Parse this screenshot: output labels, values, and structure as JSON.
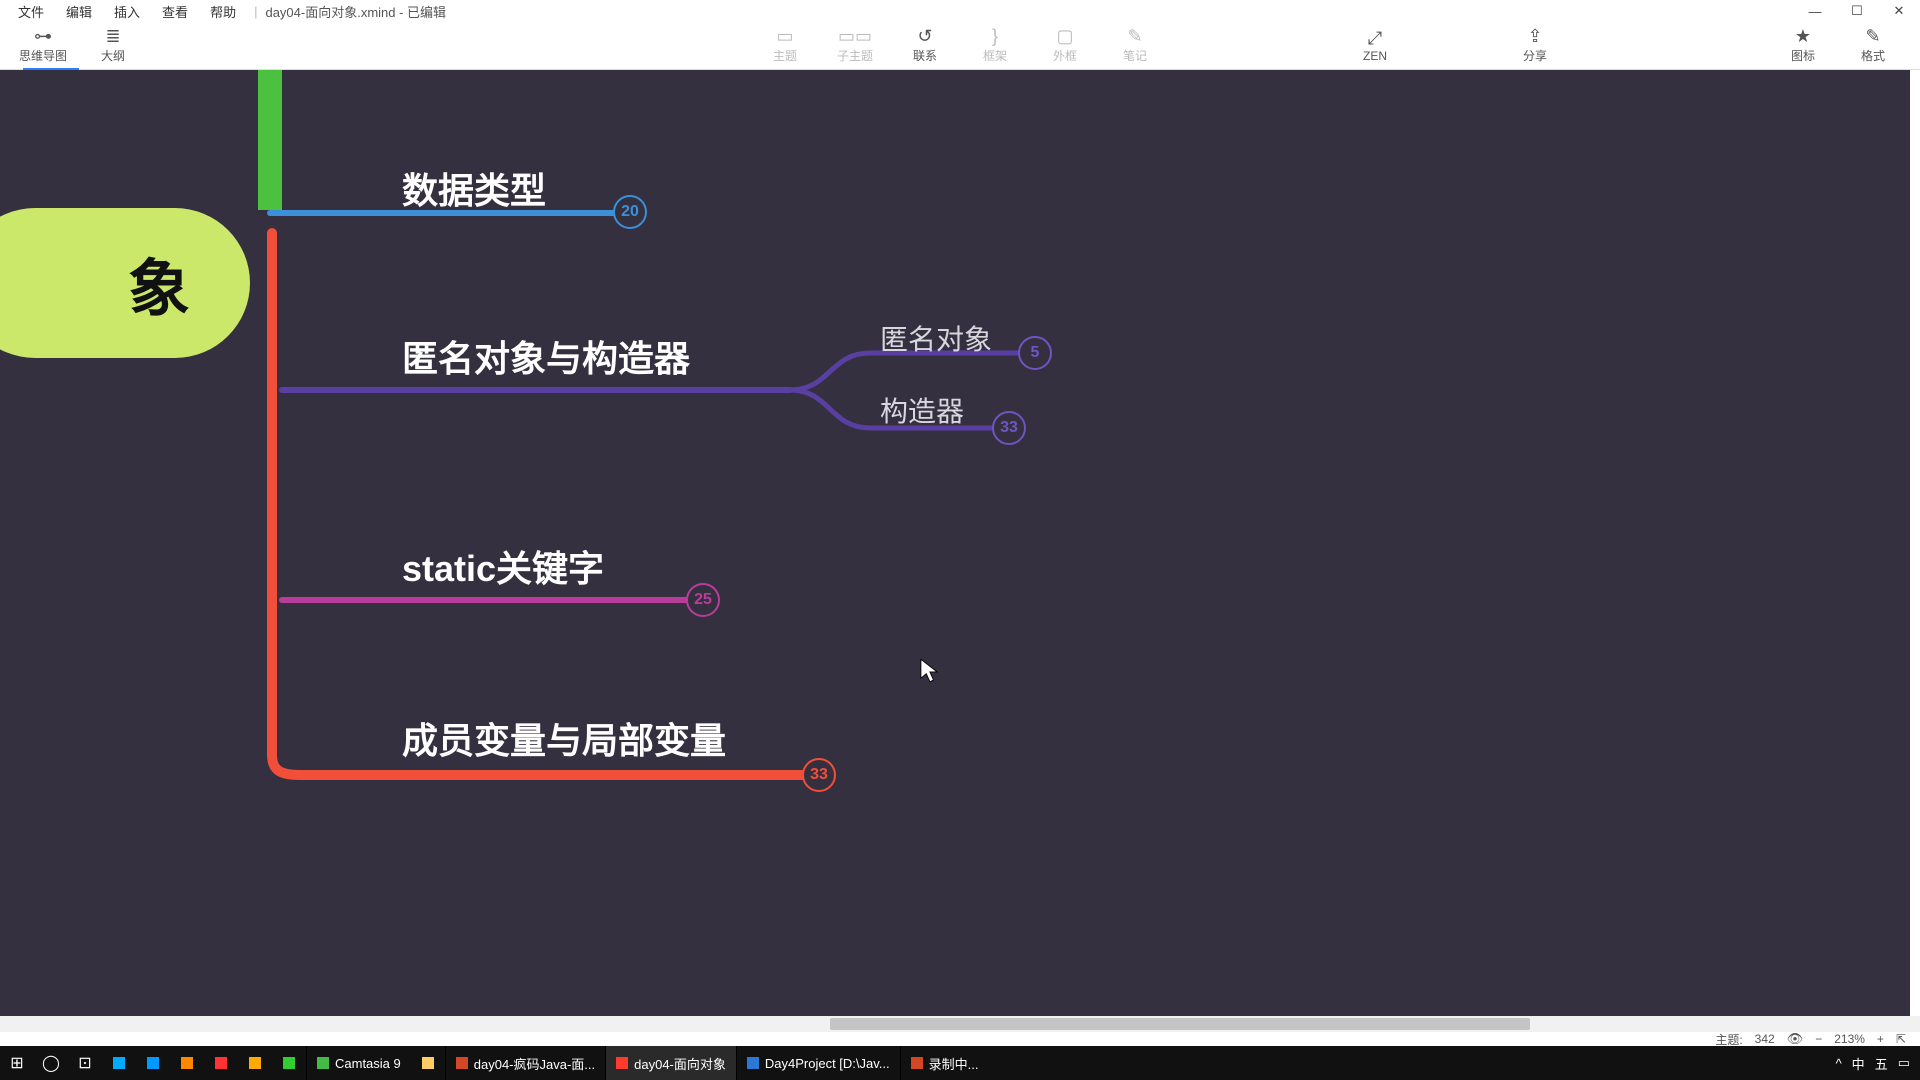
{
  "menubar": {
    "file": "文件",
    "edit": "编辑",
    "insert": "插入",
    "view": "查看",
    "help": "帮助"
  },
  "window": {
    "title": "day04-面向对象.xmind - 已编辑"
  },
  "toolbar": {
    "mindmap": "思维导图",
    "outline": "大纲",
    "theme": "主题",
    "child": "子主题",
    "relation": "联系",
    "summary": "框架",
    "boundary": "外框",
    "note": "笔记",
    "zen": "ZEN",
    "share": "分享",
    "marker": "图标",
    "format": "格式"
  },
  "mind": {
    "root": "象",
    "topics": {
      "data_type": "数据类型",
      "anon_ctor": "匿名对象与构造器",
      "static_kw": "static关键字",
      "member_local": "成员变量与局部变量"
    },
    "sub": {
      "anon": "匿名对象",
      "ctor": "构造器"
    },
    "badges": {
      "data_type": "20",
      "anon": "5",
      "ctor": "33",
      "static_kw": "25",
      "member_local": "33"
    }
  },
  "status": {
    "topic_label": "主题:",
    "topic_count": "342",
    "zoom": "213%"
  },
  "taskbar": {
    "camtasia": "Camtasia 9",
    "ppt": "day04-疯码Java-面...",
    "xmind": "day04-面向对象",
    "idea": "Day4Project [D:\\Jav...",
    "rec": "录制中..."
  }
}
